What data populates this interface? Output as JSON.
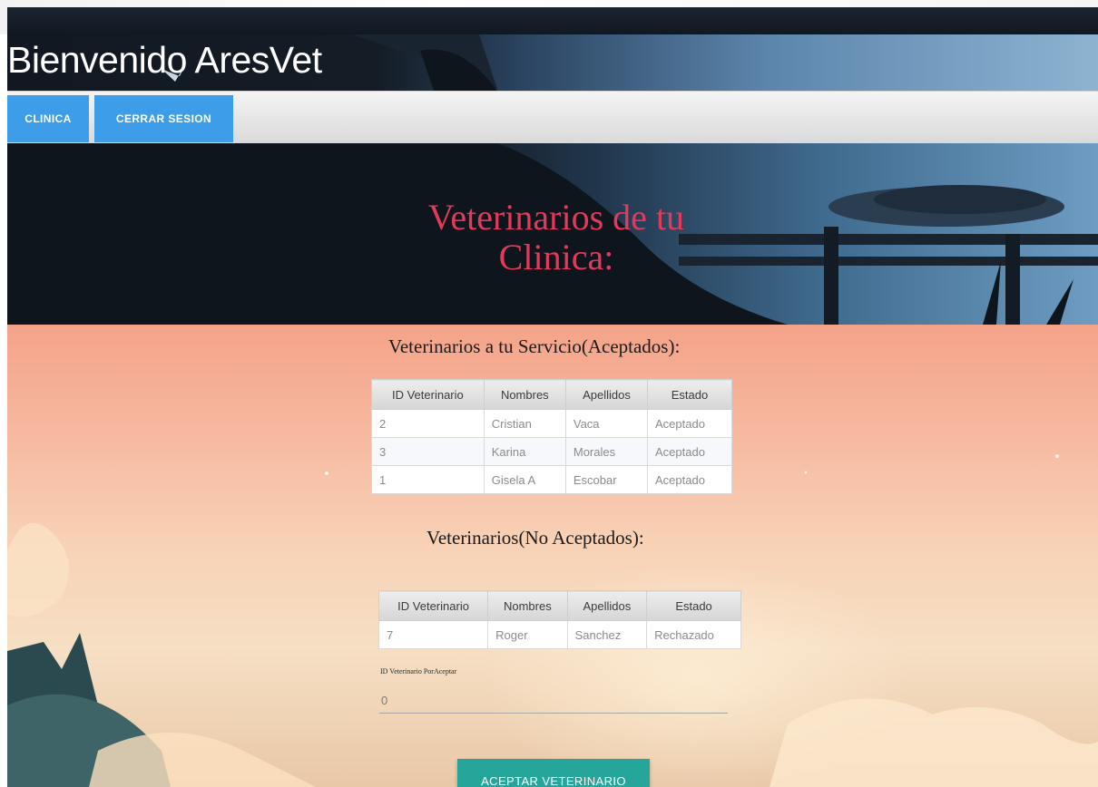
{
  "header": {
    "title": "Bienvenido AresVet"
  },
  "nav": {
    "items": [
      {
        "label": "CLINICA"
      },
      {
        "label": "CERRAR SESION"
      }
    ]
  },
  "hero": {
    "title": "Veterinarios de tu Clinica:"
  },
  "accepted": {
    "title": "Veterinarios a tu Servicio(Aceptados):",
    "columns": [
      "ID Veterinario",
      "Nombres",
      "Apellidos",
      "Estado"
    ],
    "rows": [
      [
        "2",
        "Cristian",
        "Vaca",
        "Aceptado"
      ],
      [
        "3",
        "Karina",
        "Morales",
        "Aceptado"
      ],
      [
        "1",
        "Gisela A",
        "Escobar",
        "Aceptado"
      ]
    ]
  },
  "not_accepted": {
    "title": "Veterinarios(No Aceptados):",
    "columns": [
      "ID Veterinario",
      "Nombres",
      "Apellidos",
      "Estado"
    ],
    "rows": [
      [
        "7",
        "Roger",
        "Sanchez",
        "Rechazado"
      ]
    ]
  },
  "form": {
    "id_label": "ID Veterinario PorAceptar",
    "id_value": "0",
    "submit_label": "ACEPTAR VETERINARIO"
  }
}
